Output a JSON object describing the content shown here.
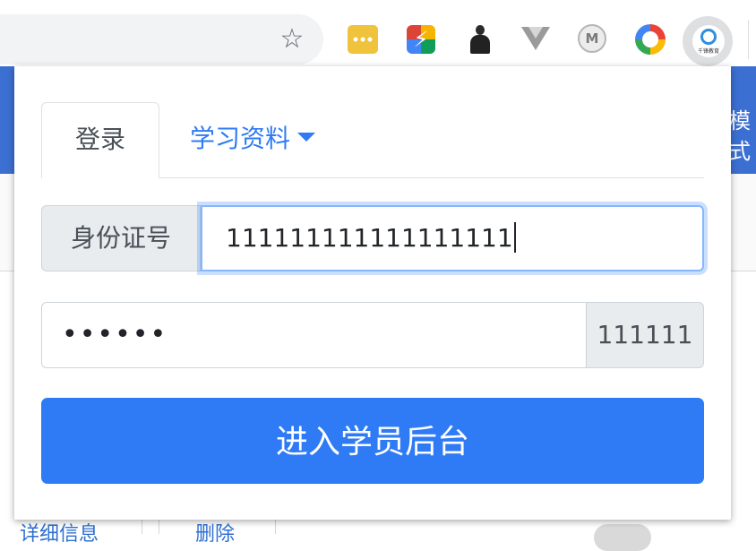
{
  "browser": {
    "extensions": [
      {
        "name": "message-ext-icon"
      },
      {
        "name": "bolt-ext-icon"
      },
      {
        "name": "person-ext-icon"
      },
      {
        "name": "vue-devtools-icon"
      },
      {
        "name": "m-ext-icon"
      },
      {
        "name": "color-ring-ext-icon"
      },
      {
        "name": "qianfeng-ext-icon",
        "caption": "千锋教育"
      }
    ],
    "star_glyph": "☆"
  },
  "background_page": {
    "band_text": "模式",
    "bottom_links": [
      "详细信息",
      "删除"
    ],
    "colors": {
      "band": "#3b6fd2"
    }
  },
  "popup": {
    "tabs": {
      "login": "登录",
      "materials": "学习资料"
    },
    "id_row": {
      "label": "身份证号",
      "value": "111111111111111111"
    },
    "password_row": {
      "value": "••••••",
      "addon": "111111"
    },
    "submit_label": "进入学员后台",
    "colors": {
      "primary": "#2f7bf5",
      "addon_bg": "#e9ecef"
    }
  }
}
